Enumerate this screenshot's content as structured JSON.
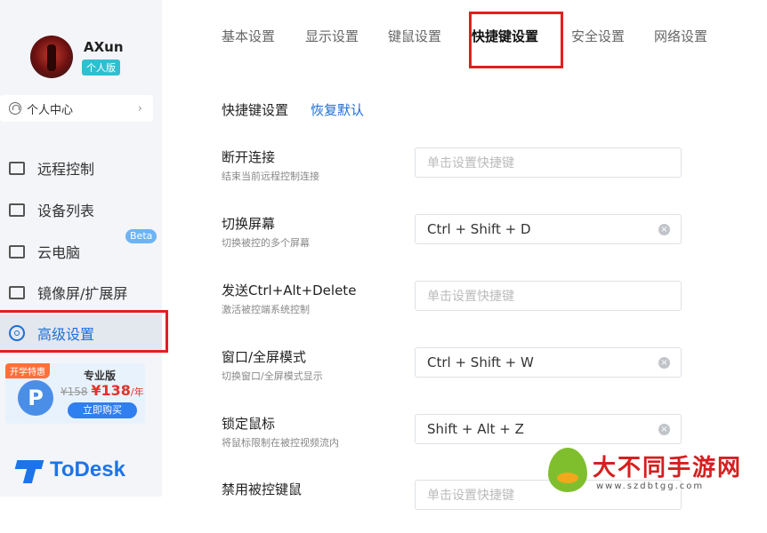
{
  "user": {
    "name": "AXun",
    "edition": "个人版"
  },
  "sidebar": {
    "personal_center": "个人中心",
    "items": [
      {
        "label": "远程控制",
        "icon": "monitor-icon"
      },
      {
        "label": "设备列表",
        "icon": "devices-icon"
      },
      {
        "label": "云电脑",
        "icon": "cloud-pc-icon",
        "badge": "Beta"
      },
      {
        "label": "镜像屏/扩展屏",
        "icon": "mirror-screen-icon"
      },
      {
        "label": "高级设置",
        "icon": "settings-icon",
        "active": true
      }
    ],
    "promo": {
      "tag": "开学特惠",
      "product": "专业版",
      "old_price": "¥158",
      "new_price": "¥138",
      "unit": "/年",
      "buy_label": "立即购买"
    },
    "logo_text": "ToDesk"
  },
  "tabs": [
    {
      "label": "基本设置"
    },
    {
      "label": "显示设置"
    },
    {
      "label": "键鼠设置"
    },
    {
      "label": "快捷键设置",
      "active": true
    },
    {
      "label": "安全设置"
    },
    {
      "label": "网络设置"
    }
  ],
  "section": {
    "title": "快捷键设置",
    "restore": "恢复默认"
  },
  "shortcuts": [
    {
      "title": "断开连接",
      "desc": "结束当前远程控制连接",
      "value": "",
      "placeholder": "单击设置快捷键"
    },
    {
      "title": "切换屏幕",
      "desc": "切换被控的多个屏幕",
      "value": "Ctrl + Shift + D",
      "placeholder": ""
    },
    {
      "title": "发送Ctrl+Alt+Delete",
      "desc": "激活被控端系统控制",
      "value": "",
      "placeholder": "单击设置快捷键"
    },
    {
      "title": "窗口/全屏模式",
      "desc": "切换窗口/全屏模式显示",
      "value": "Ctrl + Shift + W",
      "placeholder": ""
    },
    {
      "title": "锁定鼠标",
      "desc": "将鼠标限制在被控视频流内",
      "value": "Shift + Alt + Z",
      "placeholder": ""
    },
    {
      "title": "禁用被控键鼠",
      "desc": "",
      "value": "",
      "placeholder": "单击设置快捷键"
    }
  ],
  "watermark": {
    "text": "大不同手游网",
    "url": "www.szdbtgg.com"
  },
  "colors": {
    "accent": "#1c6fd8",
    "highlight_box": "#e02020"
  }
}
